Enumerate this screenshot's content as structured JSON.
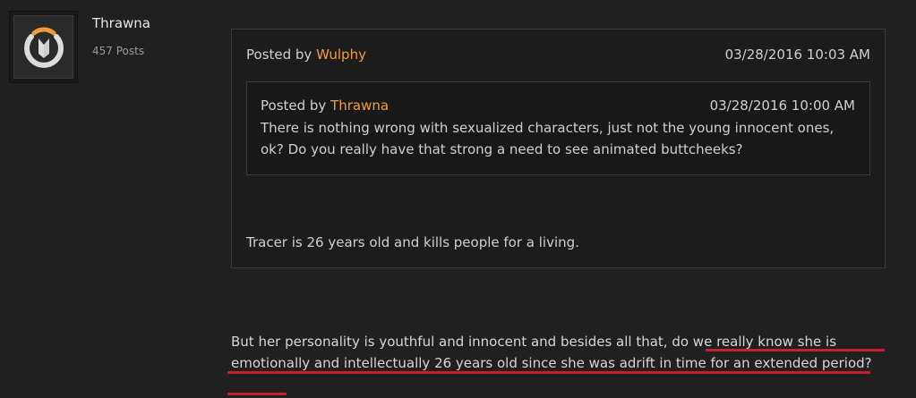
{
  "author": {
    "name": "Thrawna",
    "posts": "457 Posts",
    "avatar_icon": "overwatch-logo-icon"
  },
  "outer_quote": {
    "posted_by_prefix": "Posted by ",
    "posted_by_name": "Wulphy",
    "date": "03/28/2016 10:03 AM",
    "text": "Tracer is 26 years old and kills people for a living."
  },
  "inner_quote": {
    "posted_by_prefix": "Posted by ",
    "posted_by_name": "Thrawna",
    "date": "03/28/2016 10:00 AM",
    "text": "There is nothing wrong with sexualized characters, just not the young innocent ones, ok? Do you really have that strong a need to see animated buttcheeks?"
  },
  "body": {
    "text": "But her personality is youthful and innocent and besides all that, do we really know she is emotionally and intellectually 26 years old since she was adrift in time for an extended period?"
  },
  "colors": {
    "background": "#202020",
    "username_accent": "#f29c38",
    "underline": "#c8202a"
  }
}
